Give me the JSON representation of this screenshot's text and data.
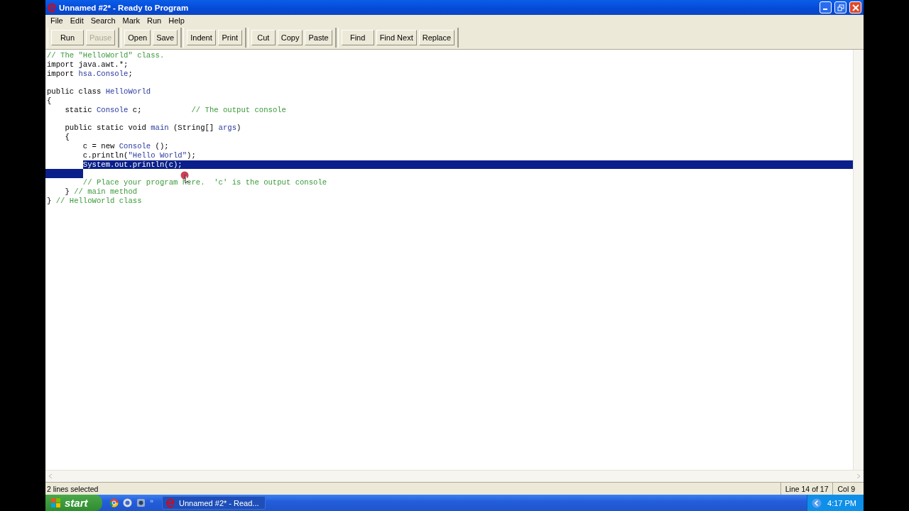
{
  "window": {
    "title": "Unnamed #2* - Ready to Program"
  },
  "menu": [
    "File",
    "Edit",
    "Search",
    "Mark",
    "Run",
    "Help"
  ],
  "toolbar": [
    [
      {
        "label": "Run",
        "disabled": false
      },
      {
        "label": "Pause",
        "disabled": true
      }
    ],
    [
      {
        "label": "Open",
        "disabled": false
      },
      {
        "label": "Save",
        "disabled": false
      }
    ],
    [
      {
        "label": "Indent",
        "disabled": false
      },
      {
        "label": "Print",
        "disabled": false
      }
    ],
    [
      {
        "label": "Cut",
        "disabled": false
      },
      {
        "label": "Copy",
        "disabled": false
      },
      {
        "label": "Paste",
        "disabled": false
      }
    ],
    [
      {
        "label": "Find",
        "disabled": false
      },
      {
        "label": "Find Next",
        "disabled": false
      },
      {
        "label": "Replace",
        "disabled": false
      }
    ]
  ],
  "editor": {
    "lines": [
      {
        "selected": false,
        "tokens": [
          {
            "kind": "comment",
            "text": "// The \"HelloWorld\" class."
          }
        ]
      },
      {
        "selected": false,
        "tokens": [
          {
            "kind": "plain",
            "text": "import java.awt.*;"
          }
        ]
      },
      {
        "selected": false,
        "tokens": [
          {
            "kind": "plain",
            "text": "import "
          },
          {
            "kind": "name",
            "text": "hsa.Console"
          },
          {
            "kind": "plain",
            "text": ";"
          }
        ]
      },
      {
        "selected": false
      },
      {
        "selected": false,
        "tokens": [
          {
            "kind": "plain",
            "text": "public class "
          },
          {
            "kind": "name",
            "text": "HelloWorld"
          }
        ]
      },
      {
        "selected": false,
        "tokens": [
          {
            "kind": "plain",
            "text": "{"
          }
        ]
      },
      {
        "selected": false,
        "tokens": [
          {
            "kind": "plain",
            "text": "    static "
          },
          {
            "kind": "name",
            "text": "Console"
          },
          {
            "kind": "plain",
            "text": " c;           "
          },
          {
            "kind": "comment",
            "text": "// The output console"
          }
        ]
      },
      {
        "selected": false
      },
      {
        "selected": false,
        "tokens": [
          {
            "kind": "plain",
            "text": "    public static void "
          },
          {
            "kind": "name",
            "text": "main"
          },
          {
            "kind": "plain",
            "text": " (String[] "
          },
          {
            "kind": "name",
            "text": "args"
          },
          {
            "kind": "plain",
            "text": ")"
          }
        ]
      },
      {
        "selected": false,
        "tokens": [
          {
            "kind": "plain",
            "text": "    {"
          }
        ]
      },
      {
        "selected": false,
        "tokens": [
          {
            "kind": "plain",
            "text": "        c = new "
          },
          {
            "kind": "name",
            "text": "Console"
          },
          {
            "kind": "plain",
            "text": " ();"
          }
        ]
      },
      {
        "selected": false,
        "tokens": [
          {
            "kind": "plain",
            "text": "        c.println("
          },
          {
            "kind": "string",
            "text": "\"Hello World\""
          },
          {
            "kind": "plain",
            "text": ");"
          }
        ]
      },
      {
        "selected": true,
        "tokens": [
          {
            "kind": "plain",
            "text": "        System.out.println(c);"
          }
        ]
      },
      {
        "selected": true
      },
      {
        "selected": false,
        "tokens": [
          {
            "kind": "comment",
            "text": "        // Place your program here.  'c' is the output console"
          }
        ]
      },
      {
        "selected": false,
        "tokens": [
          {
            "kind": "plain",
            "text": "    } "
          },
          {
            "kind": "comment",
            "text": "// main method"
          }
        ]
      },
      {
        "selected": false,
        "tokens": [
          {
            "kind": "plain",
            "text": "} "
          },
          {
            "kind": "comment",
            "text": "// HelloWorld class"
          }
        ]
      }
    ]
  },
  "status_bar": {
    "message": "2 lines selected",
    "line": "Line 14 of 17",
    "column": "Col 9"
  },
  "taskbar": {
    "start": "start",
    "more": "»",
    "task": "Unnamed #2* - Read...",
    "clock": "4:17 PM"
  }
}
